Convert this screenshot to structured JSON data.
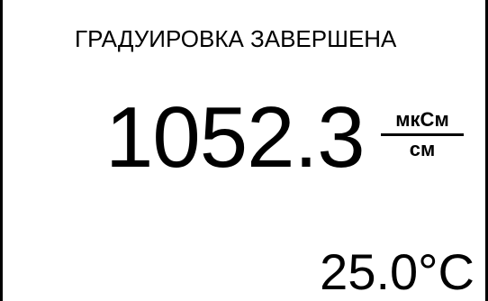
{
  "display": {
    "status_message": "ГРАДУИРОВКА ЗАВЕРШЕНА",
    "reading": {
      "value": "1052.3",
      "unit_numerator": "мкСм",
      "unit_denominator": "см"
    },
    "temperature": "25.0°C"
  },
  "colors": {
    "background": "#ffffff",
    "foreground": "#000000"
  }
}
